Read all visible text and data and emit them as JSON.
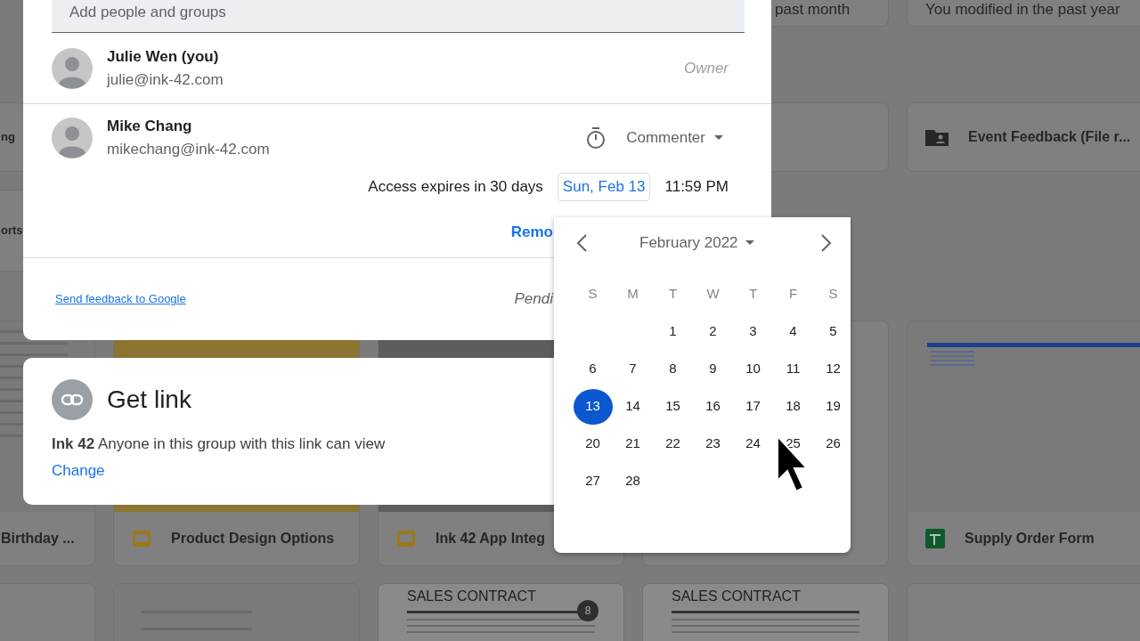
{
  "background": {
    "tiles": [
      {
        "kind": "heading",
        "title": "past month"
      },
      {
        "kind": "heading",
        "title": "You modified in the past year"
      },
      {
        "kind": "cut",
        "title": "ng"
      },
      {
        "kind": "blank"
      },
      {
        "kind": "folder",
        "title": "Event Feedback (File r..."
      },
      {
        "kind": "cut",
        "title": "orts"
      },
      {
        "kind": "document",
        "title": "Birthday ..."
      },
      {
        "kind": "slides",
        "title": "Product Design Options"
      },
      {
        "kind": "slides",
        "title": "Ink 42 App Integ"
      },
      {
        "kind": "blank"
      },
      {
        "kind": "sheet",
        "title": "Supply Order Form"
      },
      {
        "kind": "blank"
      },
      {
        "kind": "preview"
      },
      {
        "kind": "preview",
        "heading": "SALES CONTRACT",
        "badge": "8"
      },
      {
        "kind": "preview",
        "heading": "SALES CONTRACT"
      },
      {
        "kind": "blank"
      }
    ]
  },
  "share_dialog": {
    "field": {
      "placeholder": "Add people and groups"
    },
    "people": [
      {
        "name": "Julie Wen (you)",
        "email": "julie@ink-42.com",
        "role": "Owner",
        "kind": "owner"
      },
      {
        "name": "Mike Chang",
        "email": "mikechang@ink-42.com",
        "role": "Commenter",
        "kind": "editable",
        "timed": true,
        "expiry": {
          "label": "Access expires in 30 days",
          "date": "Sun, Feb 13",
          "time": "11:59 PM"
        },
        "action": "Remo"
      }
    ],
    "footer": {
      "link": "Send feedback to Google",
      "status": "Pendi"
    }
  },
  "get_link": {
    "title": "Get link",
    "description": "**Ink 42** Anyone in this group with this link can view",
    "action": "Change"
  },
  "calendar": {
    "month": "February 2022",
    "weekdays": [
      "S",
      "M",
      "T",
      "W",
      "T",
      "F",
      "S"
    ],
    "weeks": [
      [
        {
          "label": "1",
          "selected": false
        },
        {
          "label": "2",
          "selected": false
        },
        {
          "label": "3",
          "selected": false
        },
        {
          "label": "4",
          "selected": false
        },
        {
          "label": "5",
          "selected": false
        }
      ],
      [
        {
          "label": "6",
          "selected": false
        },
        {
          "label": "7",
          "selected": false
        },
        {
          "label": "8",
          "selected": false
        },
        {
          "label": "9",
          "selected": false
        },
        {
          "label": "10",
          "selected": false
        },
        {
          "label": "11",
          "selected": false
        },
        {
          "label": "12",
          "selected": false
        }
      ],
      [
        {
          "label": "13",
          "selected": true
        },
        {
          "label": "14",
          "selected": false
        },
        {
          "label": "15",
          "selected": false
        },
        {
          "label": "16",
          "selected": false
        },
        {
          "label": "17",
          "selected": false
        },
        {
          "label": "18",
          "selected": false
        },
        {
          "label": "19",
          "selected": false
        }
      ],
      [
        {
          "label": "20",
          "selected": false
        },
        {
          "label": "21",
          "selected": false
        },
        {
          "label": "22",
          "selected": false
        },
        {
          "label": "23",
          "selected": false
        },
        {
          "label": "24",
          "selected": false
        },
        {
          "label": "25",
          "selected": false
        },
        {
          "label": "26",
          "selected": false
        }
      ],
      [
        {
          "label": "27",
          "selected": false
        },
        {
          "label": "28",
          "selected": false
        }
      ]
    ]
  }
}
